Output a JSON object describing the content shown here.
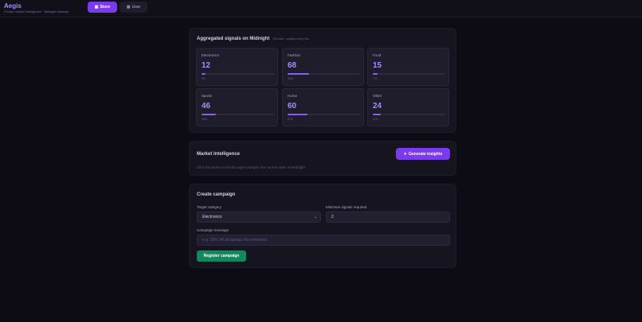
{
  "app": {
    "title": "Aegis",
    "subtitle": "Private market intelligence · Midnight Network"
  },
  "nav": {
    "store": {
      "label": "Store",
      "icon": "store-icon"
    },
    "user": {
      "label": "User",
      "icon": "user-icon"
    },
    "active": "store"
  },
  "signals": {
    "title": "Aggregated signals on Midnight",
    "meta": "225 total · updates every 10s",
    "categories": [
      {
        "label": "Electronics",
        "value": "12",
        "pct": "5%",
        "fill": 0.05
      },
      {
        "label": "Fashion",
        "value": "68",
        "pct": "30%",
        "fill": 0.3
      },
      {
        "label": "Food",
        "value": "15",
        "pct": "7%",
        "fill": 0.07
      },
      {
        "label": "Sports",
        "value": "46",
        "pct": "20%",
        "fill": 0.2
      },
      {
        "label": "Home",
        "value": "60",
        "pct": "27%",
        "fill": 0.27
      },
      {
        "label": "Other",
        "value": "24",
        "pct": "11%",
        "fill": 0.11
      }
    ]
  },
  "intel": {
    "title": "Market Intelligence",
    "description": "Click the button to let the agent analyze the current state of Midnight",
    "button_label": "Generate insights",
    "button_icon": "sparkle-icon"
  },
  "campaign": {
    "title": "Create campaign",
    "category_label": "Target category",
    "category_value": "Electronics",
    "min_signals_label": "Minimum signals required",
    "min_signals_value": "2",
    "message_label": "Campaign message",
    "message_placeholder": "e.g. 20% off all laptops this weekend",
    "register_label": "Register campaign"
  },
  "colors": {
    "accent": "#7c3aed",
    "accent_text": "#a78bfa",
    "success": "#0f8a5f",
    "background": "#0d0c14"
  }
}
